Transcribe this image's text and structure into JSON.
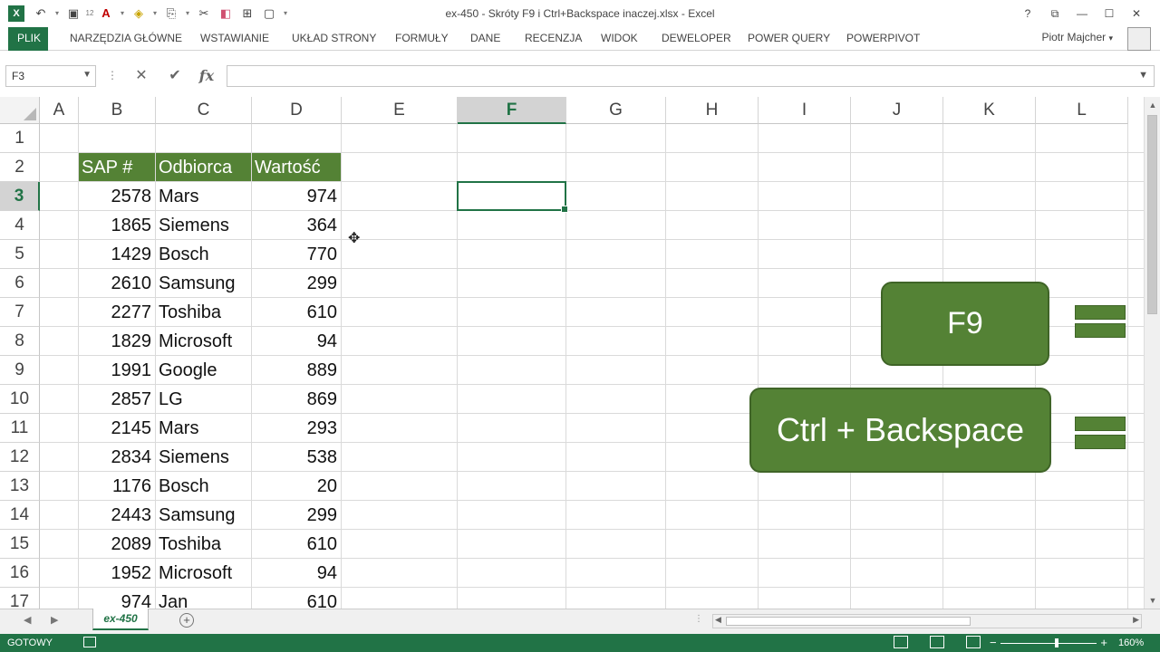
{
  "window": {
    "title": "ex-450 - Skróty F9 i Ctrl+Backspace inaczej.xlsx - Excel",
    "app_icon": "X",
    "qat_badge": "12",
    "controls": [
      "?",
      "⧉",
      "—",
      "☐",
      "✕"
    ]
  },
  "ribbon": {
    "file_tab": "PLIK",
    "tabs": [
      {
        "label": "NARZĘDZIA GŁÓWNE"
      },
      {
        "label": "WSTAWIANIE"
      },
      {
        "label": "UKŁAD STRONY"
      },
      {
        "label": "FORMUŁY"
      },
      {
        "label": "DANE"
      },
      {
        "label": "RECENZJA"
      },
      {
        "label": "WIDOK"
      },
      {
        "label": "DEWELOPER"
      },
      {
        "label": "POWER QUERY"
      },
      {
        "label": "POWERPIVOT"
      }
    ],
    "user": "Piotr Majcher"
  },
  "formula_bar": {
    "name_box": "F3",
    "fx": "fx",
    "cancel": "✕",
    "enter": "✔",
    "formula": ""
  },
  "grid": {
    "selected_column": "F",
    "selected_row": "3",
    "columns": [
      "A",
      "B",
      "C",
      "D",
      "E",
      "F",
      "G",
      "H",
      "I",
      "J",
      "K",
      "L"
    ],
    "rows": [
      "1",
      "2",
      "3",
      "4",
      "5",
      "6",
      "7",
      "8",
      "9",
      "10",
      "11",
      "12",
      "13",
      "14",
      "15",
      "16",
      "17"
    ],
    "table_header": {
      "sap": "SAP #",
      "odbiorca": "Odbiorca",
      "wartosc": "Wartość"
    },
    "table_rows": [
      {
        "sap": "2578",
        "odbiorca": "Mars",
        "wartosc": "974"
      },
      {
        "sap": "1865",
        "odbiorca": "Siemens",
        "wartosc": "364"
      },
      {
        "sap": "1429",
        "odbiorca": "Bosch",
        "wartosc": "770"
      },
      {
        "sap": "2610",
        "odbiorca": "Samsung",
        "wartosc": "299"
      },
      {
        "sap": "2277",
        "odbiorca": "Toshiba",
        "wartosc": "610"
      },
      {
        "sap": "1829",
        "odbiorca": "Microsoft",
        "wartosc": "94"
      },
      {
        "sap": "1991",
        "odbiorca": "Google",
        "wartosc": "889"
      },
      {
        "sap": "2857",
        "odbiorca": "LG",
        "wartosc": "869"
      },
      {
        "sap": "2145",
        "odbiorca": "Mars",
        "wartosc": "293"
      },
      {
        "sap": "2834",
        "odbiorca": "Siemens",
        "wartosc": "538"
      },
      {
        "sap": "1176",
        "odbiorca": "Bosch",
        "wartosc": "20"
      },
      {
        "sap": "2443",
        "odbiorca": "Samsung",
        "wartosc": "299"
      },
      {
        "sap": "2089",
        "odbiorca": "Toshiba",
        "wartosc": "610"
      },
      {
        "sap": "1952",
        "odbiorca": "Microsoft",
        "wartosc": "94"
      },
      {
        "sap": "974",
        "odbiorca": "Jan",
        "wartosc": "610"
      }
    ]
  },
  "shapes": {
    "f9_label": "F9",
    "ctrl_backspace_label": "Ctrl + Backspace",
    "shape_color": "#548235"
  },
  "sheets": {
    "active": "ex-450",
    "add_symbol": "⊕"
  },
  "status": {
    "ready": "GOTOWY",
    "zoom": "160%"
  },
  "colors": {
    "excel_green": "#217346",
    "table_header_green": "#548235"
  }
}
